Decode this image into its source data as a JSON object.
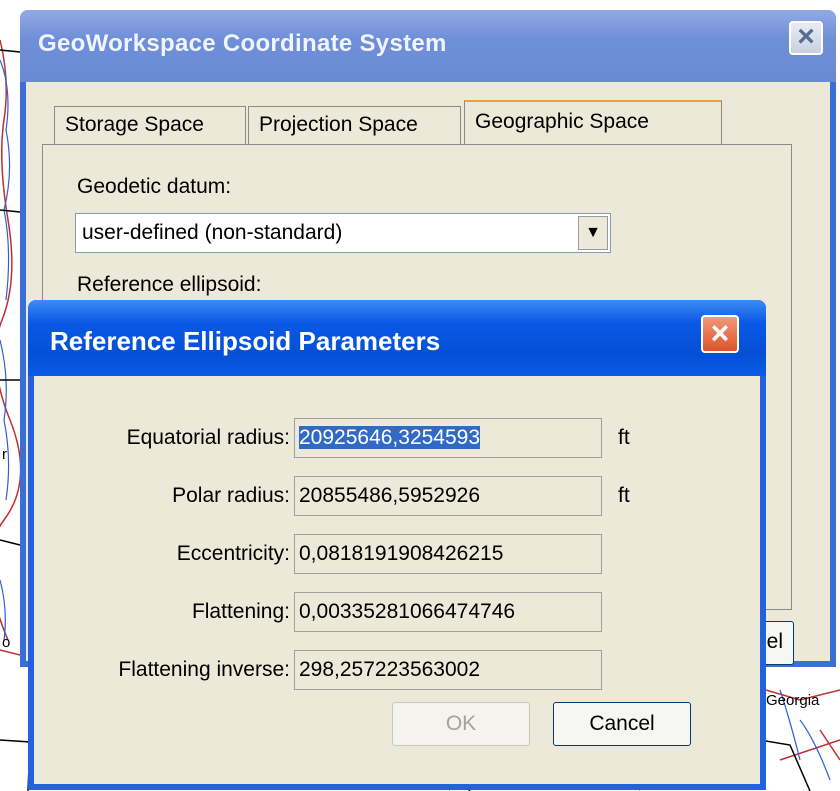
{
  "background_map": {
    "label": "Georgia",
    "left_label": "o",
    "left_label_2": "r"
  },
  "back_window": {
    "title": "GeoWorkspace Coordinate System",
    "close_icon": "close-icon",
    "tabs": [
      {
        "label": "Storage Space"
      },
      {
        "label": "Projection Space"
      },
      {
        "label": "Geographic Space",
        "active": true
      }
    ],
    "geodetic_datum_label": "Geodetic datum:",
    "geodetic_datum_value": "user-defined (non-standard)",
    "reference_ellipsoid_label": "Reference ellipsoid:",
    "cancel_partial": "el"
  },
  "dialog": {
    "title": "Reference Ellipsoid Parameters",
    "close_icon": "close-icon",
    "fields": [
      {
        "label": "Equatorial radius:",
        "value": "20925646,3254593",
        "unit": "ft",
        "selected": true
      },
      {
        "label": "Polar radius:",
        "value": "20855486,5952926",
        "unit": "ft"
      },
      {
        "label": "Eccentricity:",
        "value": "0,0818191908426215"
      },
      {
        "label": "Flattening:",
        "value": "0,00335281066474746"
      },
      {
        "label": "Flattening inverse:",
        "value": "298,257223563002"
      }
    ],
    "ok_label": "OK",
    "cancel_label": "Cancel"
  },
  "colors": {
    "titlebar_active": "#0450d6",
    "titlebar_inactive": "#6a8ad6",
    "dialog_face": "#ece9d8",
    "close_active": "#e0522a",
    "selection": "#316ac5"
  }
}
